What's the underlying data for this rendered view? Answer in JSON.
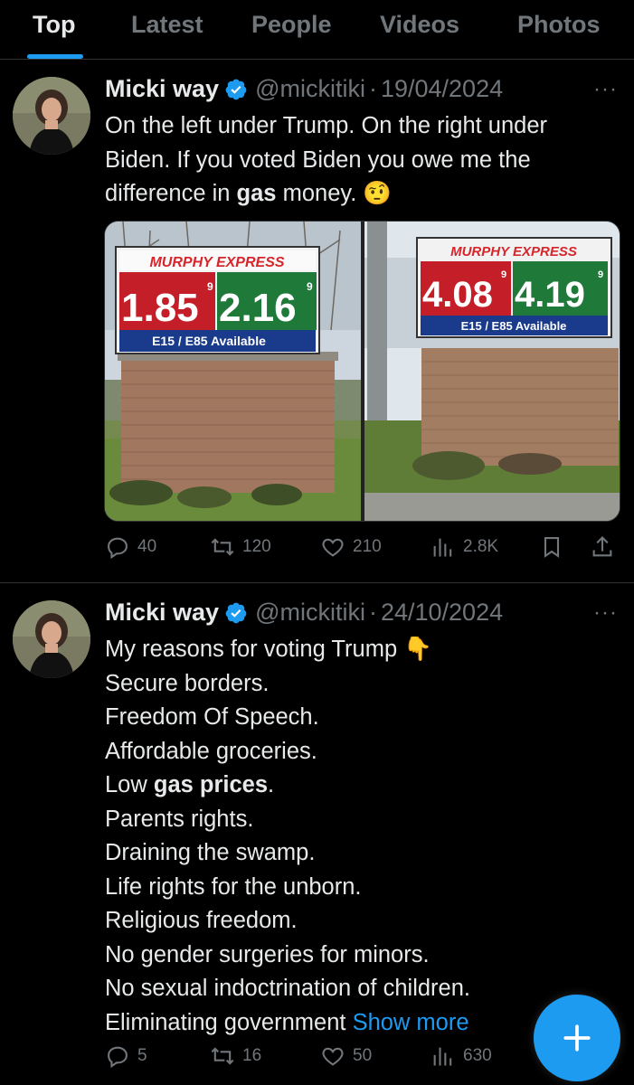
{
  "tabs": [
    {
      "label": "Top",
      "active": true
    },
    {
      "label": "Latest",
      "active": false
    },
    {
      "label": "People",
      "active": false
    },
    {
      "label": "Videos",
      "active": false
    },
    {
      "label": "Photos",
      "active": false
    }
  ],
  "tweets": [
    {
      "name": "Micki way",
      "handle": "@mickitiki",
      "separator": "·",
      "date": "19/04/2024",
      "text_lines": [
        "On the left under Trump. On the right under",
        "Biden. If you voted Biden you owe me the",
        "difference in "
      ],
      "bold_word": "gas",
      "text_tail": " money.",
      "emoji": "🤨",
      "media": {
        "left_sign": {
          "brand": "MURPHY EXPRESS",
          "price_unl": "1.85",
          "price_unl_frac": "9",
          "price_dsl": "2.16",
          "price_dsl_frac": "9",
          "banner": "E15 / E85 Available"
        },
        "right_sign": {
          "brand": "MURPHY EXPRESS",
          "price_unl": "4.08",
          "price_unl_frac": "9",
          "price_dsl": "4.19",
          "price_dsl_frac": "9",
          "banner": "E15 / E85 Available"
        }
      },
      "replies": "40",
      "retweets": "120",
      "likes": "210",
      "views": "2.8K"
    },
    {
      "name": "Micki way",
      "handle": "@mickitiki",
      "separator": "·",
      "date": "24/10/2024",
      "first_line": "My reasons for voting Trump",
      "first_emoji": "👇",
      "lines": [
        "Secure borders.",
        "Freedom Of Speech.",
        "Affordable groceries."
      ],
      "low_prefix": "Low ",
      "low_bold": "gas prices",
      "low_suffix": ".",
      "lines2": [
        "Parents rights.",
        "Draining the swamp.",
        "Life rights for the unborn.",
        "Religious freedom.",
        "No gender surgeries for minors.",
        "No sexual indoctrination of children."
      ],
      "last_line": "Eliminating government ",
      "show_more": "Show more",
      "replies": "5",
      "retweets": "16",
      "likes": "50",
      "views": "630"
    }
  ],
  "more_icon": "···",
  "colors": {
    "accent": "#1d9bf0",
    "muted": "#71767b",
    "text": "#e7e9ea",
    "border": "#2f3336"
  }
}
